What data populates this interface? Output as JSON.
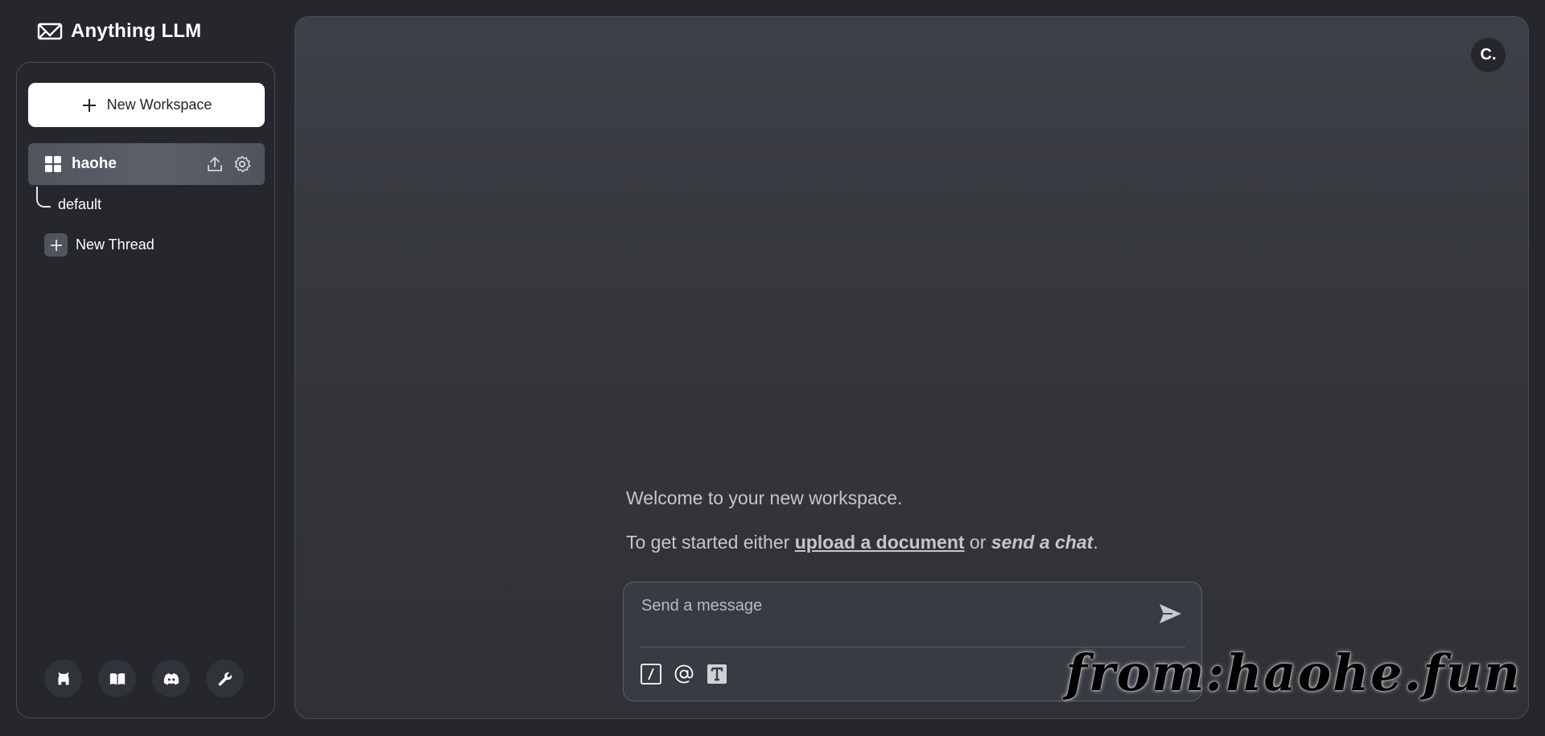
{
  "app": {
    "title": "Anything LLM"
  },
  "sidebar": {
    "new_workspace_label": "New Workspace",
    "workspace": {
      "name": "haohe"
    },
    "threads": [
      {
        "label": "default"
      }
    ],
    "new_thread_label": "New Thread",
    "footer_icons": [
      "github-icon",
      "book-icon",
      "discord-icon",
      "wrench-icon"
    ]
  },
  "main": {
    "avatar_label": "C.",
    "welcome_text": "Welcome to your new workspace.",
    "get_started": {
      "prefix": "To get started either ",
      "upload_link": "upload a document",
      "middle": " or ",
      "chat_link": "send a chat",
      "suffix": "."
    },
    "composer": {
      "placeholder": "Send a message"
    }
  },
  "watermark": "from:haohe.fun",
  "colors": {
    "background": "#25272c",
    "panel": "#3a3c43",
    "accent": "#ffffff"
  }
}
